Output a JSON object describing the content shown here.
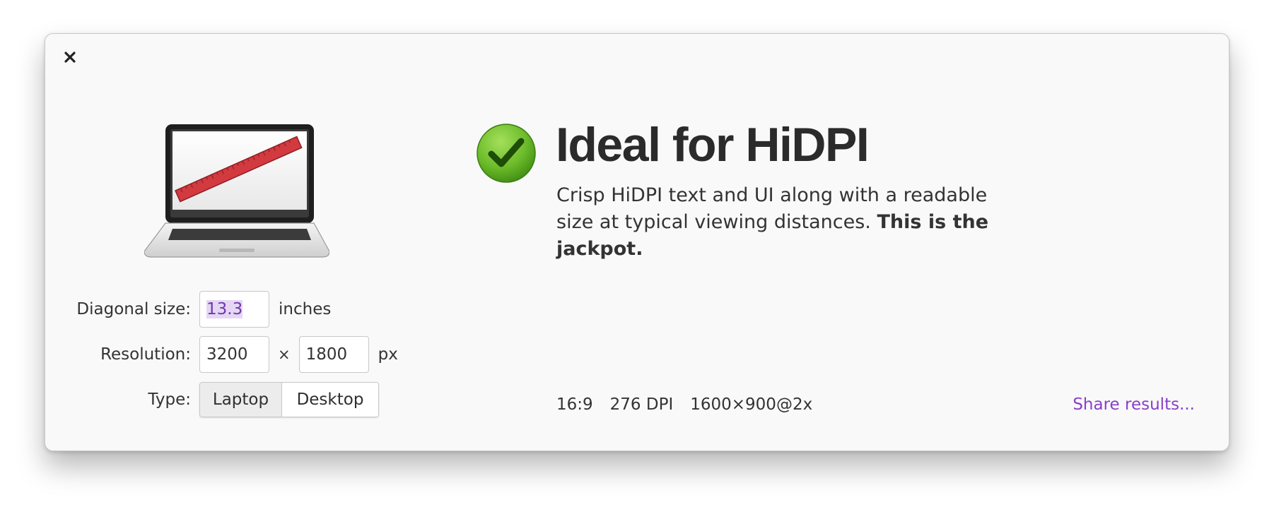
{
  "window": {
    "close_icon": "close-x-icon"
  },
  "illustration": {
    "icon": "laptop-with-ruler-icon"
  },
  "form": {
    "diagonal": {
      "label": "Diagonal size:",
      "value": "13.3",
      "unit": "inches"
    },
    "resolution": {
      "label": "Resolution:",
      "width": "3200",
      "times": "×",
      "height": "1800",
      "unit": "px"
    },
    "type": {
      "label": "Type:",
      "options": [
        "Laptop",
        "Desktop"
      ],
      "selected": "Laptop"
    }
  },
  "result": {
    "status_icon": "green-checkmark-icon",
    "headline": "Ideal for HiDPI",
    "description": "Crisp HiDPI text and UI along with a readable size at typical viewing distances.",
    "description_bold": "This is the jackpot.",
    "stats": {
      "aspect_ratio": "16:9",
      "dpi": "276 DPI",
      "scaled_resolution": "1600×900@2x"
    },
    "share_label": "Share results..."
  },
  "colors": {
    "accent_link": "#8a3fc9",
    "selection_bg": "#e6d6f5",
    "check_green": "#6cbb2a",
    "ruler_red": "#d23a3f"
  }
}
